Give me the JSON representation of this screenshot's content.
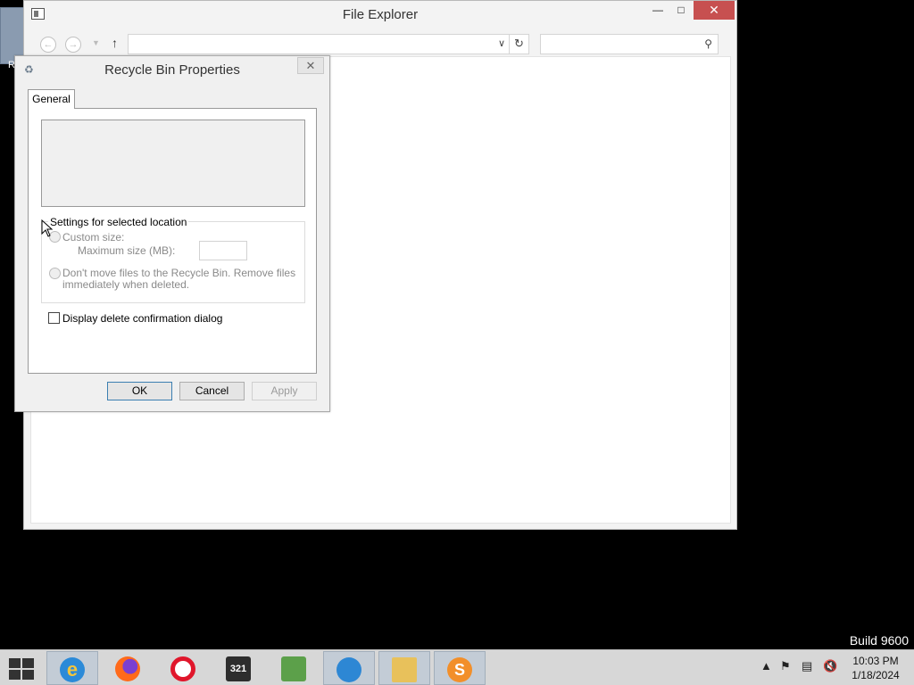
{
  "desktop": {
    "icon_label": "R"
  },
  "explorer": {
    "title": "File Explorer",
    "address_value": "",
    "search_placeholder": ""
  },
  "dialog": {
    "title": "Recycle Bin Properties",
    "tab_general": "General",
    "group_label": "Settings for selected location",
    "custom_size_label": "Custom size:",
    "max_size_label": "Maximum size (MB):",
    "max_size_value": "",
    "dont_move_label_line1": "Don't move files to the Recycle Bin. Remove files",
    "dont_move_label_line2": "immediately when deleted.",
    "confirm_label": "Display delete confirmation dialog",
    "ok": "OK",
    "cancel": "Cancel",
    "apply": "Apply"
  },
  "watermark": {
    "build": "Build 9600"
  },
  "taskbar": {
    "apps": [
      {
        "name": "internet-explorer",
        "active": true
      },
      {
        "name": "firefox",
        "active": false
      },
      {
        "name": "opera",
        "active": false
      },
      {
        "name": "media-player-classic",
        "active": false
      },
      {
        "name": "package-installer",
        "active": false
      },
      {
        "name": "thunderbird",
        "active": true
      },
      {
        "name": "file-explorer",
        "active": true
      },
      {
        "name": "sublime-text",
        "active": true
      }
    ],
    "clock_time": "10:03 PM",
    "clock_date": "1/18/2024"
  },
  "colors": {
    "close_button": "#c75050",
    "desktop": "#000000",
    "taskbar": "#d7d7d7"
  }
}
